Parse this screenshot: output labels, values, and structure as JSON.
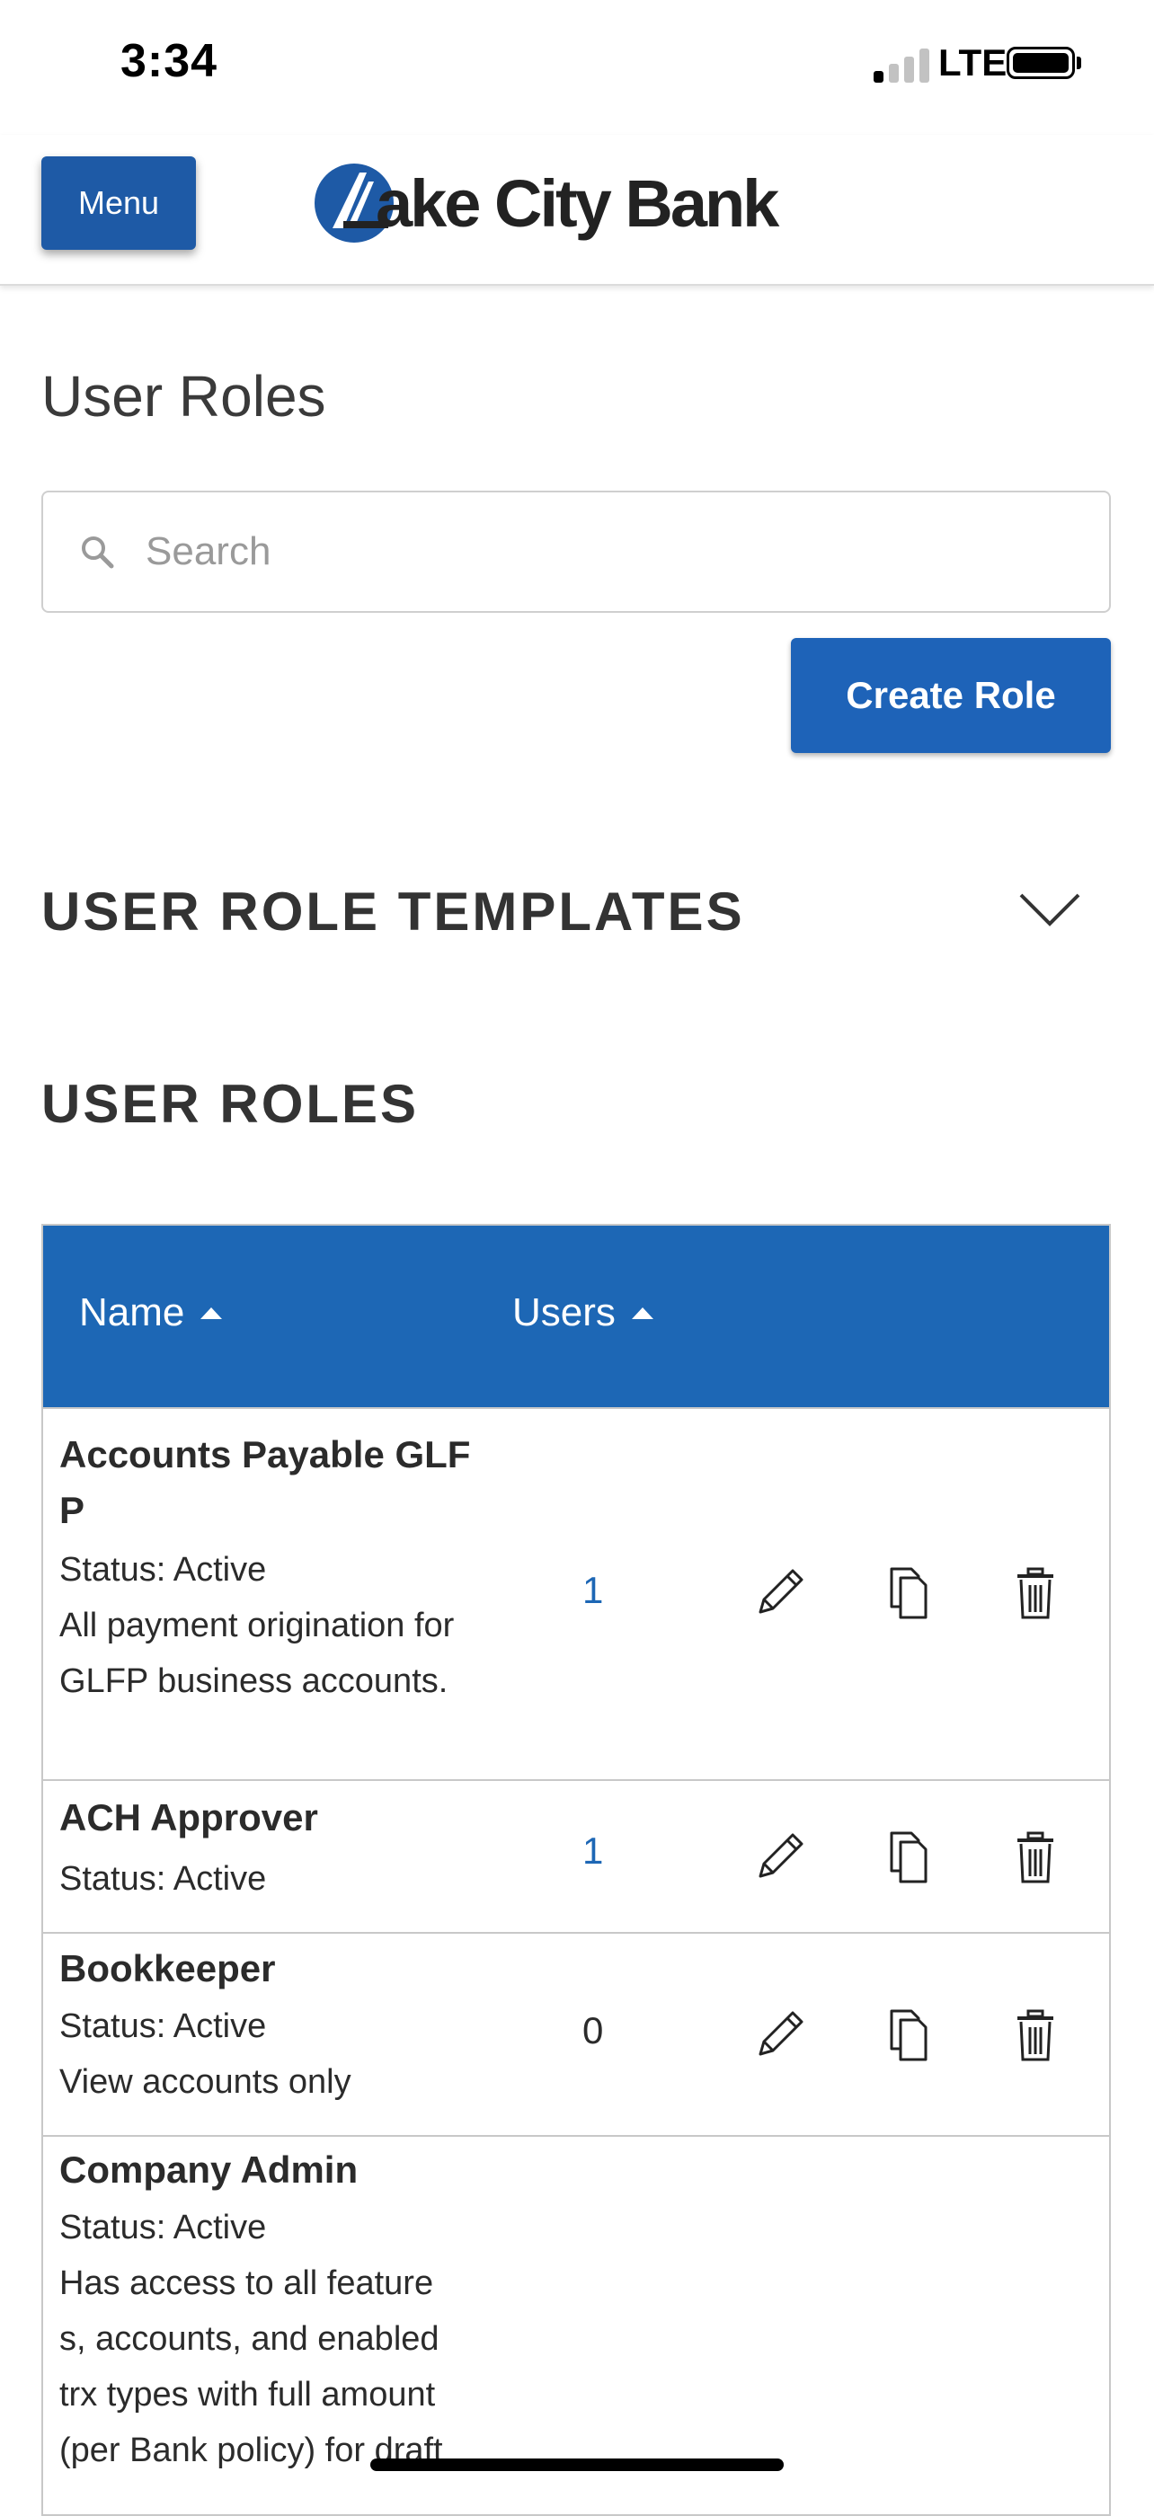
{
  "status_bar": {
    "time": "3:34",
    "network": "LTE"
  },
  "header": {
    "menu_label": "Menu",
    "logo_text": "ake City Bank",
    "logo_full": "Lake City Bank"
  },
  "page": {
    "title": "User Roles",
    "search_placeholder": "Search",
    "create_label": "Create Role",
    "templates_heading": "USER ROLE TEMPLATES",
    "roles_heading": "USER ROLES"
  },
  "table": {
    "headers": {
      "name": "Name",
      "users": "Users"
    },
    "rows": [
      {
        "name": "Accounts Payable GLFP",
        "status": "Status: Active",
        "description": "All payment origination for GLFP business accounts.",
        "users": "1"
      },
      {
        "name": "ACH Approver",
        "status": "Status: Active",
        "description": "",
        "users": "1"
      },
      {
        "name": "Bookkeeper",
        "status": "Status: Active",
        "description": "View accounts only",
        "users": "0"
      },
      {
        "name": "Company Admin",
        "status": "Status: Active",
        "description": "Has access to all features, accounts, and enabled trx types with full amount (per Bank policy) for draft",
        "users": ""
      }
    ]
  },
  "colors": {
    "brand_blue": "#1e5aa6",
    "header_blue": "#1d67b5",
    "link_blue": "#1d67b5"
  }
}
